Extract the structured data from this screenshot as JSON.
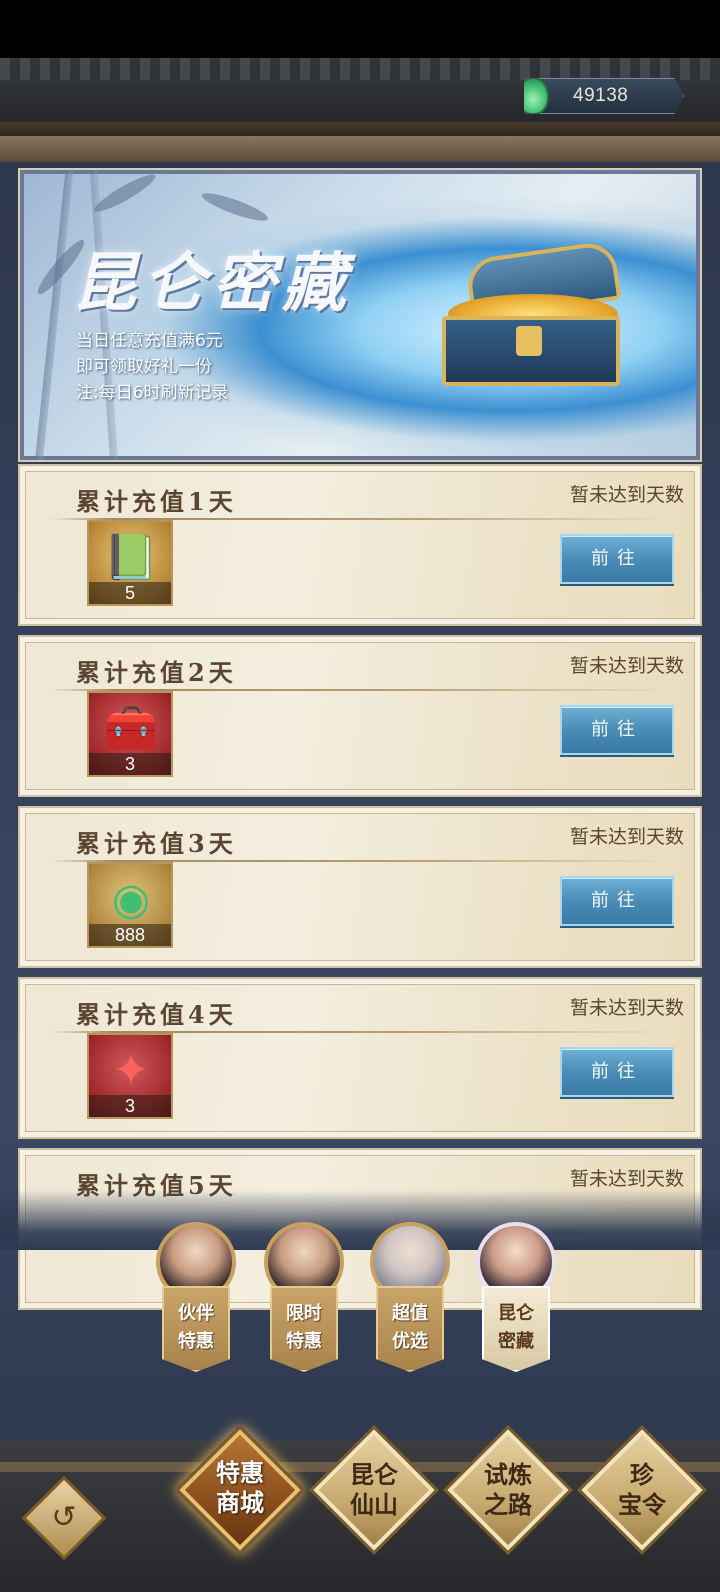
{
  "header": {
    "currency_icon": "jade-coin-icon",
    "currency_amount": "49138"
  },
  "banner": {
    "title": "昆仑密藏",
    "lines": [
      "当日任意充值满6元",
      "即可领取好礼一份",
      "注:每日6时刷新记录"
    ],
    "image": "treasure-chest"
  },
  "rewards": [
    {
      "title": "累计充值1天",
      "status": "暂未达到天数",
      "item_icon": "book-icon",
      "count": "5",
      "button": "前往"
    },
    {
      "title": "累计充值2天",
      "status": "暂未达到天数",
      "item_icon": "chest-icon",
      "count": "3",
      "button": "前往"
    },
    {
      "title": "累计充值3天",
      "status": "暂未达到天数",
      "item_icon": "jade-coin-icon",
      "count": "888",
      "button": "前往"
    },
    {
      "title": "累计充值4天",
      "status": "暂未达到天数",
      "item_icon": "talisman-icon",
      "count": "3",
      "button": "前往"
    },
    {
      "title": "累计充值5天",
      "status": "暂未达到天数"
    }
  ],
  "subnav": [
    {
      "line1": "伙伴",
      "line2": "特惠"
    },
    {
      "line1": "限时",
      "line2": "特惠"
    },
    {
      "line1": "超值",
      "line2": "优选"
    },
    {
      "line1": "昆仑",
      "line2": "密藏"
    }
  ],
  "bottom_nav": [
    {
      "line1": "特惠",
      "line2": "商城",
      "active": true
    },
    {
      "line1": "昆仑",
      "line2": "仙山",
      "active": false
    },
    {
      "line1": "试炼",
      "line2": "之路",
      "active": false
    },
    {
      "line1": "珍",
      "line2": "宝令",
      "active": false
    }
  ],
  "back_icon": "back-arrow-icon"
}
